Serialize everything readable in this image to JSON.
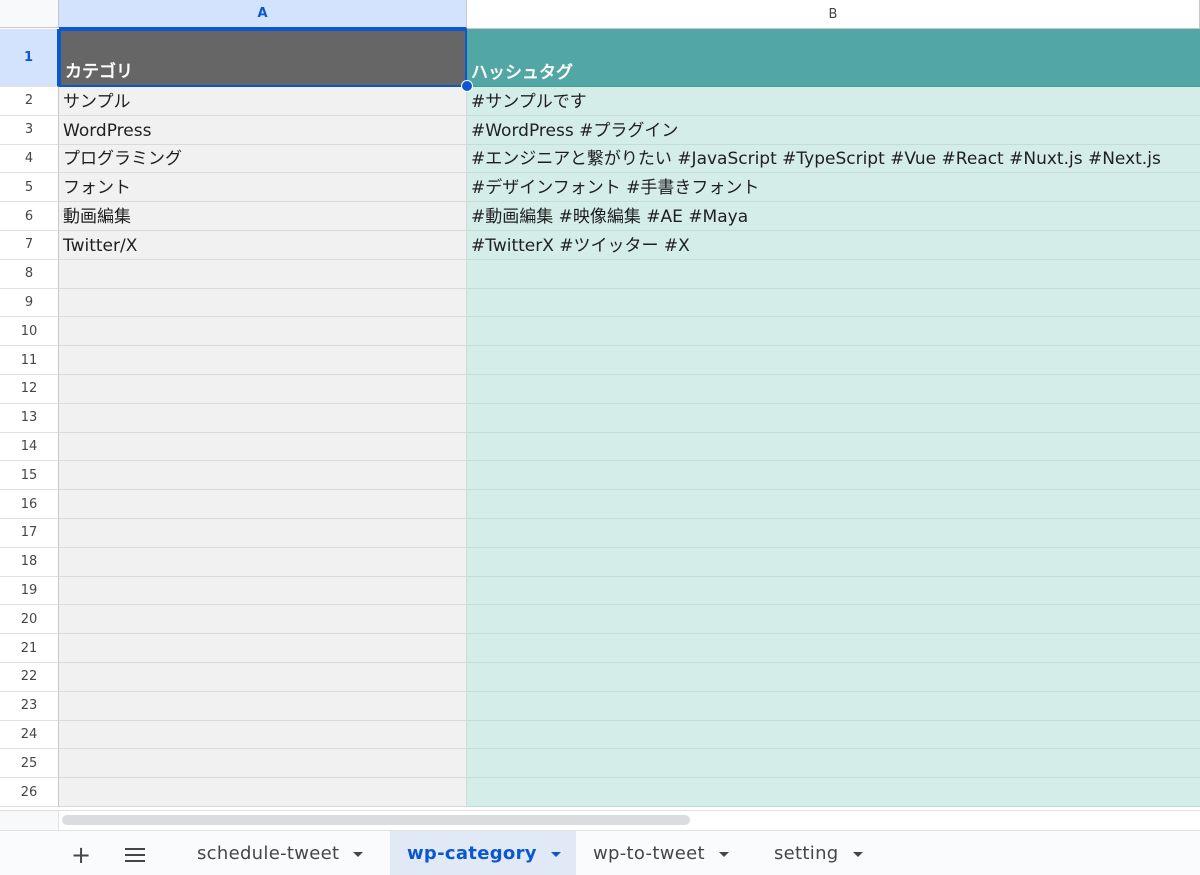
{
  "columns": [
    "A",
    "B"
  ],
  "rows": [
    {
      "num": "1",
      "a": "カテゴリ",
      "b": "ハッシュタグ"
    },
    {
      "num": "2",
      "a": "サンプル",
      "b": "#サンプルです"
    },
    {
      "num": "3",
      "a": "WordPress",
      "b": "#WordPress #プラグイン"
    },
    {
      "num": "4",
      "a": "プログラミング",
      "b": "#エンジニアと繋がりたい #JavaScript #TypeScript #Vue #React #Nuxt.js #Next.js"
    },
    {
      "num": "5",
      "a": "フォント",
      "b": "#デザインフォント #手書きフォント"
    },
    {
      "num": "6",
      "a": "動画編集",
      "b": "#動画編集 #映像編集 #AE #Maya"
    },
    {
      "num": "7",
      "a": "Twitter/X",
      "b": "#TwitterX #ツイッター #X"
    },
    {
      "num": "8",
      "a": "",
      "b": ""
    },
    {
      "num": "9",
      "a": "",
      "b": ""
    },
    {
      "num": "10",
      "a": "",
      "b": ""
    },
    {
      "num": "11",
      "a": "",
      "b": ""
    },
    {
      "num": "12",
      "a": "",
      "b": ""
    },
    {
      "num": "13",
      "a": "",
      "b": ""
    },
    {
      "num": "14",
      "a": "",
      "b": ""
    },
    {
      "num": "15",
      "a": "",
      "b": ""
    },
    {
      "num": "16",
      "a": "",
      "b": ""
    },
    {
      "num": "17",
      "a": "",
      "b": ""
    },
    {
      "num": "18",
      "a": "",
      "b": ""
    },
    {
      "num": "19",
      "a": "",
      "b": ""
    },
    {
      "num": "20",
      "a": "",
      "b": ""
    },
    {
      "num": "21",
      "a": "",
      "b": ""
    },
    {
      "num": "22",
      "a": "",
      "b": ""
    },
    {
      "num": "23",
      "a": "",
      "b": ""
    },
    {
      "num": "24",
      "a": "",
      "b": ""
    },
    {
      "num": "25",
      "a": "",
      "b": ""
    },
    {
      "num": "26",
      "a": "",
      "b": ""
    }
  ],
  "sheet_tabs": [
    {
      "label": "schedule-tweet",
      "active": false
    },
    {
      "label": "wp-category",
      "active": true
    },
    {
      "label": "wp-to-tweet",
      "active": false
    },
    {
      "label": "setting",
      "active": false
    }
  ],
  "tabbar": {
    "add_icon": "plus-icon",
    "all_sheets_icon": "menu-icon",
    "add_glyph": "+"
  },
  "colors": {
    "header_a_bg": "#666666",
    "header_b_bg": "#52a7a5",
    "col_a_bg": "#f1f1f1",
    "col_b_bg": "#d4ede9",
    "selection": "#0b57d0",
    "active_tab_bg": "#e1e9f7"
  }
}
